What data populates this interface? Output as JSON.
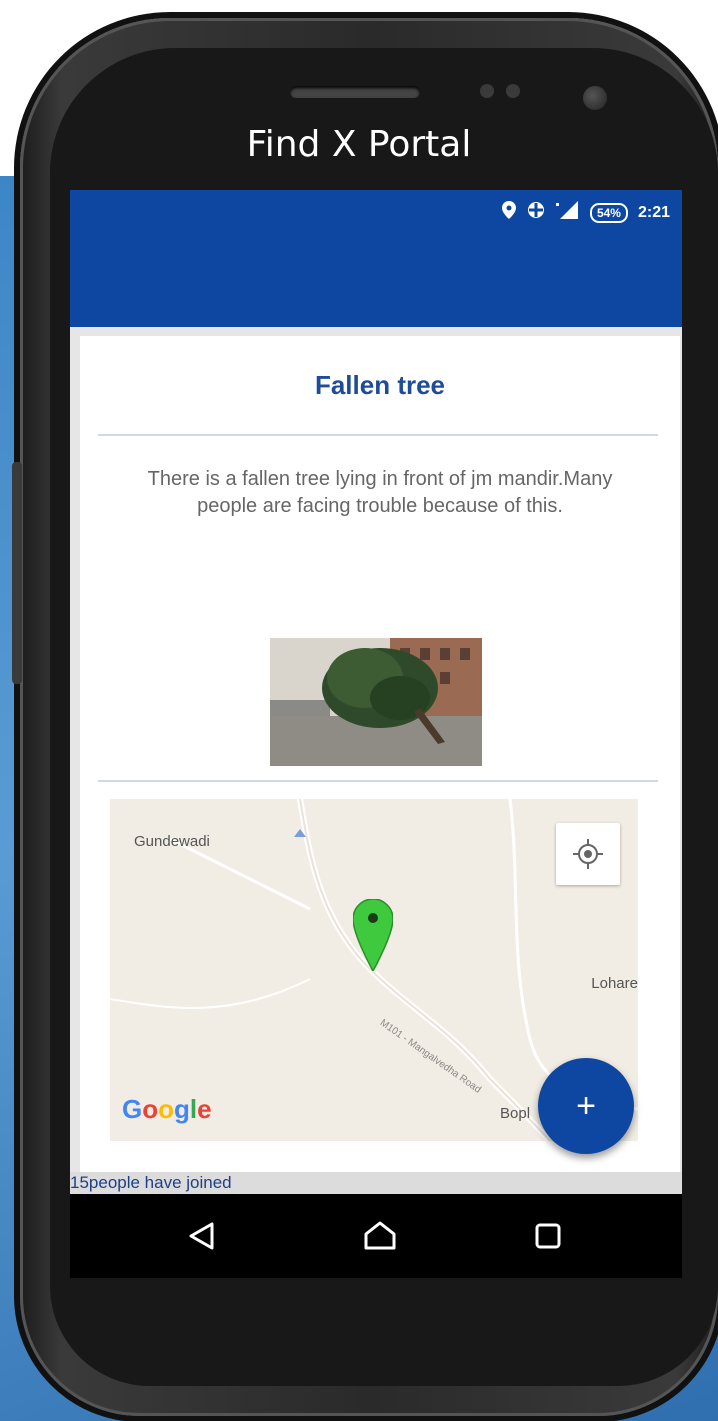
{
  "portal_title": "Find X Portal",
  "status_bar": {
    "battery": "54%",
    "time": "2:21",
    "icons": [
      "location-pin-icon",
      "data-saver-icon",
      "signal-icon",
      "battery-icon"
    ]
  },
  "post": {
    "title": "Fallen tree",
    "description": "There is a fallen tree lying in front of jm mandir.Many people are facing trouble because of this.",
    "image_alt": "fallen-tree-photo"
  },
  "map": {
    "labels": {
      "village_1": "Gundewadi",
      "village_2": "Lohare",
      "road": "M101 - Mangalvedha Road",
      "village_3": "Bopl"
    },
    "google_logo": "Google",
    "marker_color": "#3ec93e"
  },
  "fab_label": "+",
  "joined_text": "15people have joined",
  "colors": {
    "app_bar": "#0d47a1",
    "title": "#1f4c99",
    "backdrop": "#4a90cf"
  }
}
